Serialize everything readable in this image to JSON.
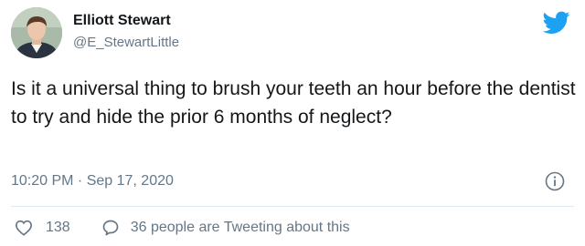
{
  "author": {
    "name": "Elliott Stewart",
    "handle": "@E_StewartLittle"
  },
  "tweet": {
    "text": "Is it a universal thing to brush your teeth an hour before the dentist to try and hide the prior 6 months of neglect?",
    "timestamp": "10:20 PM · Sep 17, 2020"
  },
  "actions": {
    "likes": "138",
    "tweeting": "36 people are Tweeting about this"
  },
  "icons": {
    "brand": "twitter-bird-icon",
    "info": "info-icon",
    "like": "heart-icon",
    "reply": "speech-bubble-icon"
  },
  "colors": {
    "brand": "#1da1f2",
    "text": "#14171a",
    "muted": "#657786",
    "divider": "#e1e8ed"
  }
}
